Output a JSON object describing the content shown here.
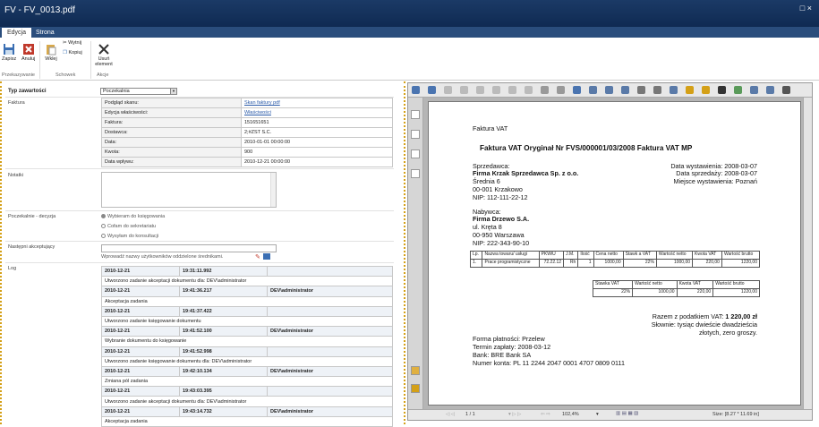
{
  "window": {
    "title": "FV - FV_0013.pdf",
    "maximize": "□ ×"
  },
  "tabs": [
    "Edycja",
    "Strona"
  ],
  "ribbon": {
    "save": "Zapisz",
    "cancel": "Anuluj",
    "paste": "Wklej",
    "cut": "Wytnij",
    "copy": "Kopiuj",
    "delete": "Usuń element",
    "groups": [
      "Przekazywanie",
      "Schowek",
      "Akcje"
    ]
  },
  "form": {
    "type_label": "Typ zawartości",
    "type_value": "Poczekalnia",
    "invoice_label": "Faktura",
    "invoice_rows": [
      {
        "k": "Podgląd skanu:",
        "v": "Skan faktury pdf",
        "link": true
      },
      {
        "k": "Edycja właściwości:",
        "v": "Właściwości",
        "link": true
      },
      {
        "k": "Faktura:",
        "v": "151651651",
        "link": false
      },
      {
        "k": "Dostawca:",
        "v": "2;#ZST S.C.",
        "link": false
      },
      {
        "k": "Data:",
        "v": "2010-01-01 00:00:00",
        "link": false
      },
      {
        "k": "Kwota:",
        "v": "900",
        "link": false
      },
      {
        "k": "Data wpływu:",
        "v": "2010-12-21 00:00:00",
        "link": false
      }
    ],
    "notes_label": "Notatki",
    "decision_label": "Poczekalnie - decyzja",
    "decisions": [
      "Wybieram do księgowania",
      "Cofam do sekretariatu",
      "Wysyłam do konsultacji"
    ],
    "next_label": "Następni akceptujący",
    "next_hint": "Wprowadź nazwy użytkowników oddzielone średnikami.",
    "log_label": "Log",
    "log": [
      {
        "date": "2010-12-21",
        "time": "19:31:11.992",
        "user": "",
        "text": "Utworzono zadanie akceptacji dokumentu dla: DEV\\administrator"
      },
      {
        "date": "2010-12-21",
        "time": "19:41:36.217",
        "user": "DEV\\administrator",
        "text": "Akceptacja zadania"
      },
      {
        "date": "2010-12-21",
        "time": "19:41:37.422",
        "user": "",
        "text": "Utworzono zadanie księgowanie dokumentu"
      },
      {
        "date": "2010-12-21",
        "time": "19:41:52.100",
        "user": "DEV\\administrator",
        "text": "Wybranie dokumentu do księgowanie"
      },
      {
        "date": "2010-12-21",
        "time": "19:41:52.998",
        "user": "",
        "text": "Utworzono zadanie księgowanie dokumentu dla: DEV\\administrator"
      },
      {
        "date": "2010-12-21",
        "time": "19:42:10.134",
        "user": "DEV\\administrator",
        "text": "Zmiana pól zadania"
      },
      {
        "date": "2010-12-21",
        "time": "19:43:03.395",
        "user": "",
        "text": "Utworzono zadanie akceptacji dokumentu dla: DEV\\administrator"
      },
      {
        "date": "2010-12-21",
        "time": "19:43:14.732",
        "user": "DEV\\administrator",
        "text": "Akceptacja zadania"
      }
    ]
  },
  "pdf": {
    "doc": "Faktura VAT",
    "heading": "Faktura VAT Oryginał Nr FVS/000001/03/2008 Faktura VAT MP",
    "seller_h": "Sprzedawca:",
    "seller_name": "Firma Krzak Sprzedawca Sp. z o.o.",
    "seller_addr1": "Średnia 6",
    "seller_addr2": "00-001 Krzakowo",
    "seller_nip": "NIP: 112-111-22-12",
    "issue": "Data wystawienia: 2008-03-07",
    "sale": "Data sprzedaży: 2008-03-07",
    "place": "Miejsce wystawienia: Poznań",
    "buyer_h": "Nabywca:",
    "buyer_name": "Firma Drzewo S.A.",
    "buyer_addr1": "ul. Kręta 8",
    "buyer_addr2": "00-950 Warszawa",
    "buyer_nip": "NIP: 222-343-90-10",
    "items_head": [
      "Lp.",
      "Nazwa towaru/ usługi",
      "PKWiU",
      "J.M.",
      "Ilość",
      "Cena netto",
      "Stawk a VAT",
      "Wartość netto",
      "Kwota VAT",
      "Wartość brutto"
    ],
    "items_row": [
      "1.",
      "Prace programistyczne",
      "72.22.12",
      "Rh",
      "1",
      "1000,00",
      "22%",
      "1000,00",
      "220,00",
      "1220,00"
    ],
    "sum_head": [
      "Stawka VAT",
      "Wartość netto",
      "Kwota VAT",
      "Wartość brutto"
    ],
    "sum_row": [
      "22%",
      "1000,00",
      "220,00",
      "1220,00"
    ],
    "total_label": "Razem z podatkiem VAT:",
    "total": "1 220,00 zł",
    "words1": "Słownie: tysiąc dwieście dwadzieścia",
    "words2": "złotych, zero groszy.",
    "pay": "Forma płatności: Przelew",
    "term": "Termin zapłaty: 2008-03-12",
    "bank": "Bank: BRE Bank SA",
    "account": "Numer konta: PL 11 2244 2047 0001 4707 0809 0111"
  },
  "viewer": {
    "page": "1 / 1",
    "zoom": "102,4%",
    "size": "Size: [8.27 * 11.69 in]"
  },
  "colors": {
    "title": "#0f2a52",
    "accent": "#d4a017"
  }
}
